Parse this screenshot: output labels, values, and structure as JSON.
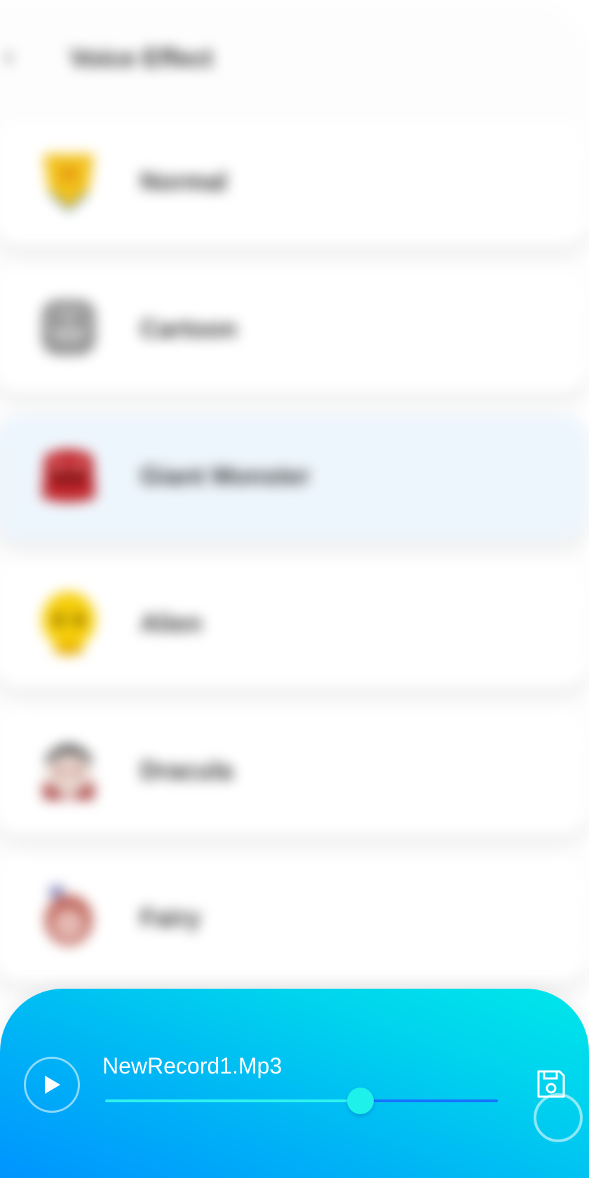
{
  "header": {
    "title": "Voice Effect",
    "back_icon": "chevron-left-icon"
  },
  "effects": [
    {
      "label": "Normal",
      "icon": "normal-avatar-icon",
      "color": "#f2c21b"
    },
    {
      "label": "Cartoon",
      "icon": "cartoon-avatar-icon",
      "color": "#8e8e8e"
    },
    {
      "label": "Giant Monster",
      "icon": "monster-avatar-icon",
      "color": "#c0262b"
    },
    {
      "label": "Alien",
      "icon": "alien-avatar-icon",
      "color": "#f7cf0a"
    },
    {
      "label": "Dracula",
      "icon": "dracula-avatar-icon",
      "color": "#a53b3b"
    },
    {
      "label": "Fairy",
      "icon": "fairy-avatar-icon",
      "color": "#c0685e"
    }
  ],
  "selected_effect": "Giant Monster",
  "player": {
    "track_name": "NewRecord1.Mp3",
    "progress": 0.65,
    "play_icon": "play-icon",
    "save_icon": "save-icon",
    "accent_color": "#1ef1ea"
  }
}
